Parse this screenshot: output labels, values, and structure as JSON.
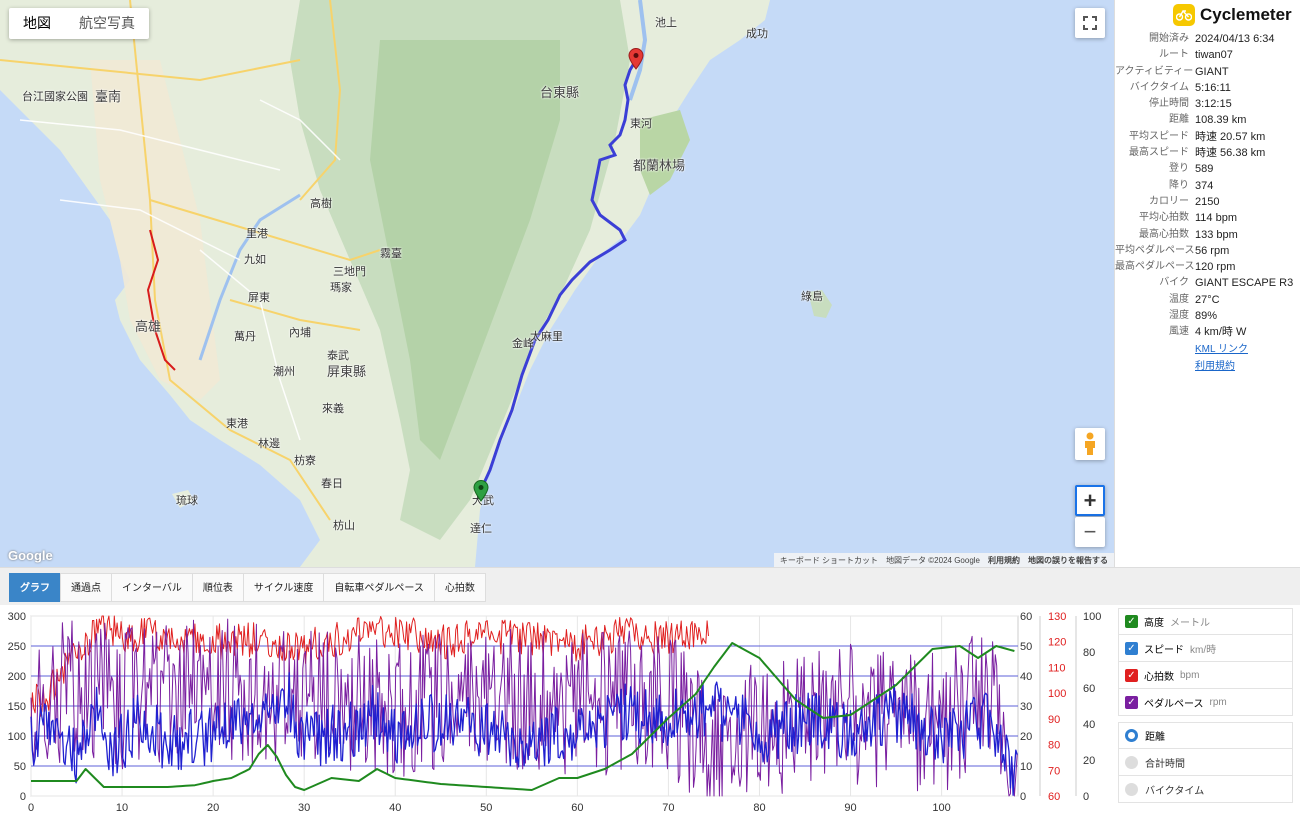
{
  "map": {
    "map_types": [
      "地図",
      "航空写真"
    ],
    "attribution": [
      "キーボード ショートカット",
      "地図データ ©2024 Google",
      "利用規約",
      "地図の誤りを報告する"
    ],
    "logo": "Google",
    "labels": [
      "台江國家公園",
      "臺南",
      "高雄",
      "里港",
      "九如",
      "屏東",
      "萬丹",
      "內埔",
      "潮州",
      "泰武",
      "屏東縣",
      "來義",
      "東港",
      "林邊",
      "枋寮",
      "琉球",
      "春日",
      "枋山",
      "三地門",
      "瑪家",
      "霧臺",
      "高樹",
      "台東縣",
      "都蘭林場",
      "綠島",
      "金峰",
      "太麻里",
      "大武",
      "達仁",
      "成功",
      "池上",
      "東河"
    ]
  },
  "app": {
    "name": "Cyclemeter"
  },
  "stats": [
    {
      "k": "開始済み",
      "v": "2024/04/13 6:34"
    },
    {
      "k": "ルート",
      "v": "tiwan07"
    },
    {
      "k": "アクティビティー",
      "v": "GIANT"
    },
    {
      "k": "バイクタイム",
      "v": "5:16:11"
    },
    {
      "k": "停止時間",
      "v": "3:12:15"
    },
    {
      "k": "距離",
      "v": "108.39 km"
    },
    {
      "k": "平均スピード",
      "v": "時速 20.57 km"
    },
    {
      "k": "最高スピード",
      "v": "時速 56.38 km"
    },
    {
      "k": "登り",
      "v": "589"
    },
    {
      "k": "降り",
      "v": "374"
    },
    {
      "k": "カロリー",
      "v": "2150"
    },
    {
      "k": "平均心拍数",
      "v": "114 bpm"
    },
    {
      "k": "最高心拍数",
      "v": "133 bpm"
    },
    {
      "k": "平均ペダルペース",
      "v": "56 rpm"
    },
    {
      "k": "最高ペダルペース",
      "v": "120 rpm"
    },
    {
      "k": "バイク",
      "v": "GIANT ESCAPE R3"
    },
    {
      "k": "温度",
      "v": "27°C"
    },
    {
      "k": "湿度",
      "v": "89%"
    },
    {
      "k": "風速",
      "v": "4 km/時 W"
    }
  ],
  "links": {
    "kml": "KML リンク",
    "terms": "利用規約"
  },
  "tabs": [
    "グラフ",
    "通過点",
    "インターバル",
    "順位表",
    "サイクル速度",
    "自転車ペダルペース",
    "心拍数"
  ],
  "legend": {
    "series": [
      {
        "label": "高度",
        "unit": "メートル",
        "color": "#1f8a1f"
      },
      {
        "label": "スピード",
        "unit": "km/時",
        "color": "#2f7fd1"
      },
      {
        "label": "心拍数",
        "unit": "bpm",
        "color": "#e02020"
      },
      {
        "label": "ペダルペース",
        "unit": "rpm",
        "color": "#7a1fa0"
      }
    ],
    "xmodes": [
      "距離",
      "合計時間",
      "バイクタイム"
    ]
  },
  "chart_data": {
    "type": "line",
    "x_ticks": [
      0,
      10,
      20,
      30,
      40,
      50,
      60,
      70,
      80,
      90,
      100
    ],
    "x_range": [
      0,
      108.39
    ],
    "axes": [
      {
        "name": "高度",
        "ticks": [
          0,
          50,
          100,
          150,
          200,
          250,
          300
        ],
        "range": [
          0,
          300
        ]
      },
      {
        "name": "スピード",
        "ticks": [
          0,
          10,
          20,
          30,
          40,
          50,
          60
        ],
        "range": [
          0,
          60
        ]
      },
      {
        "name": "心拍数",
        "ticks": [
          60,
          70,
          80,
          90,
          100,
          110,
          120,
          130
        ],
        "range": [
          60,
          130
        ]
      },
      {
        "name": "ペダルペース",
        "ticks": [
          0,
          20,
          40,
          60,
          80,
          100
        ],
        "range": [
          0,
          100
        ]
      }
    ],
    "series": [
      {
        "name": "高度",
        "x": [
          0,
          5,
          6,
          7,
          8,
          10,
          15,
          18,
          20,
          22,
          24,
          25,
          26,
          27,
          28,
          29,
          30,
          33,
          36,
          38,
          40,
          45,
          50,
          55,
          58,
          60,
          63,
          66,
          70,
          73,
          75,
          77,
          80,
          84,
          87,
          90,
          95,
          99,
          102,
          104,
          106,
          108.4
        ],
        "y": [
          25,
          25,
          45,
          30,
          15,
          15,
          15,
          18,
          25,
          30,
          45,
          70,
          85,
          65,
          35,
          15,
          10,
          30,
          25,
          45,
          30,
          20,
          15,
          10,
          30,
          30,
          45,
          70,
          130,
          170,
          215,
          255,
          230,
          160,
          130,
          135,
          185,
          245,
          250,
          230,
          250,
          240
        ]
      },
      {
        "name": "スピード",
        "x": [
          0,
          2,
          5,
          7,
          9,
          12,
          15,
          20,
          25,
          28,
          30,
          35,
          38,
          40,
          45,
          50,
          55,
          60,
          65,
          70,
          75,
          80,
          85,
          90,
          95,
          100,
          105,
          108.4
        ],
        "y": [
          18,
          22,
          12,
          28,
          15,
          25,
          18,
          20,
          25,
          34,
          18,
          22,
          28,
          20,
          25,
          22,
          18,
          22,
          28,
          25,
          30,
          20,
          25,
          22,
          28,
          20,
          25,
          5
        ]
      },
      {
        "name": "心拍数",
        "x": [
          0,
          2,
          5,
          8,
          10,
          15,
          20,
          25,
          30,
          35,
          40,
          45,
          50,
          55,
          60,
          65,
          70,
          74.5
        ],
        "y": [
          95,
          100,
          118,
          126,
          123,
          122,
          120,
          121,
          118,
          122,
          124,
          120,
          122,
          121,
          119,
          123,
          121,
          122
        ]
      },
      {
        "name": "ペダルペース",
        "x": [
          0,
          5,
          10,
          20,
          30,
          40,
          50,
          60,
          70,
          75,
          80,
          90,
          100,
          105,
          108.4
        ],
        "y": [
          50,
          60,
          55,
          60,
          55,
          50,
          55,
          50,
          55,
          20,
          40,
          45,
          40,
          60,
          10
        ]
      }
    ]
  }
}
